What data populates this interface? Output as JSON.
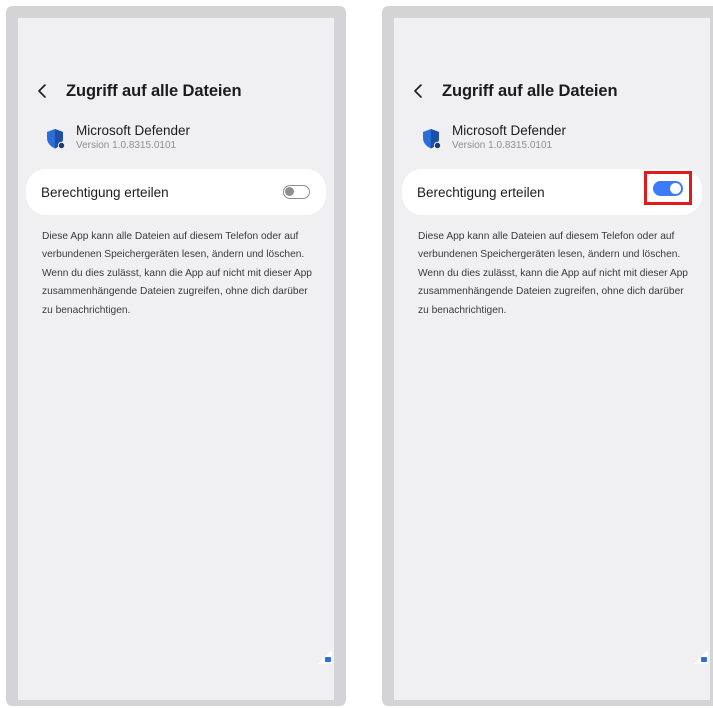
{
  "screens": [
    {
      "header": {
        "title": "Zugriff auf alle Dateien"
      },
      "app": {
        "name": "Microsoft Defender",
        "version": "Version 1.0.8315.0101"
      },
      "permission": {
        "label": "Berechtigung erteilen",
        "toggle_state": "off"
      },
      "description": "Diese App kann alle Dateien auf diesem Telefon oder auf verbundenen Speichergeräten lesen, ändern und löschen. Wenn du dies zulässt, kann die App auf nicht mit dieser App zusammenhängende Dateien zugreifen, ohne dich darüber zu benachrichtigen."
    },
    {
      "header": {
        "title": "Zugriff auf alle Dateien"
      },
      "app": {
        "name": "Microsoft Defender",
        "version": "Version 1.0.8315.0101"
      },
      "permission": {
        "label": "Berechtigung erteilen",
        "toggle_state": "on",
        "highlighted": true
      },
      "description": "Diese App kann alle Dateien auf diesem Telefon oder auf verbundenen Speichergeräten lesen, ändern und löschen. Wenn du dies zulässt, kann die App auf nicht mit dieser App zusammenhängende Dateien zugreifen, ohne dich darüber zu benachrichtigen."
    }
  ],
  "colors": {
    "toggle_on": "#3e7bfa",
    "toggle_off": "#8e8e93",
    "highlight_box": "#e11a1a",
    "screen_bg": "#f0f0f2",
    "frame_bg": "#d4d4d6"
  },
  "icons": [
    "back-chevron-icon",
    "defender-shield-icon"
  ]
}
